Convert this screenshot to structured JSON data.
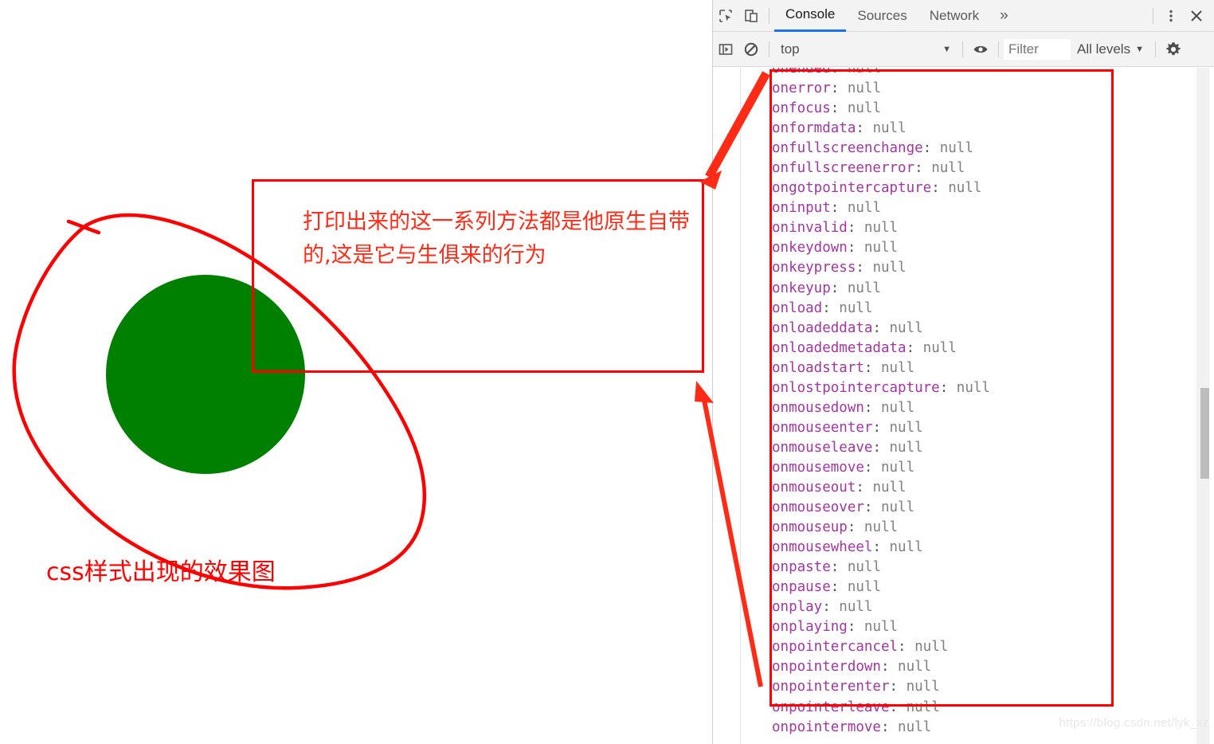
{
  "page": {
    "shapes": {
      "circle_color": "#008000",
      "annotation_color": "#ff0000"
    },
    "css_caption": "css样式出现的效果图",
    "annotation_text": "打印出来的这一系列方法都是他原生自带的,这是它与生俱来的行为"
  },
  "devtools": {
    "tabbar": {
      "inspect_icon": "inspect-element-icon",
      "device_icon": "device-toolbar-icon",
      "tabs": [
        {
          "label": "Console",
          "active": true
        },
        {
          "label": "Sources",
          "active": false
        },
        {
          "label": "Network",
          "active": false
        }
      ],
      "more_tabs": "»",
      "menu_icon": "kebab-menu-icon",
      "close_icon": "close-icon"
    },
    "filterbar": {
      "sidebar_icon": "console-sidebar-icon",
      "clear_icon": "clear-console-icon",
      "context": "top",
      "context_caret": "▼",
      "eye_icon": "live-expression-icon",
      "filter_value": "",
      "filter_placeholder": "Filter",
      "levels": "All levels",
      "levels_caret": "▼",
      "settings_icon": "gear-icon"
    },
    "console": {
      "value_text": "null",
      "separator": ": ",
      "properties": [
        "onended",
        "onerror",
        "onfocus",
        "onformdata",
        "onfullscreenchange",
        "onfullscreenerror",
        "ongotpointercapture",
        "oninput",
        "oninvalid",
        "onkeydown",
        "onkeypress",
        "onkeyup",
        "onload",
        "onloadeddata",
        "onloadedmetadata",
        "onloadstart",
        "onlostpointercapture",
        "onmousedown",
        "onmouseenter",
        "onmouseleave",
        "onmousemove",
        "onmouseout",
        "onmouseover",
        "onmouseup",
        "onmousewheel",
        "onpaste",
        "onpause",
        "onplay",
        "onplaying",
        "onpointercancel",
        "onpointerdown",
        "onpointerenter",
        "onpointerleave",
        "onpointermove"
      ]
    },
    "watermark": "https://blog.csdn.net/lyk_xz"
  }
}
